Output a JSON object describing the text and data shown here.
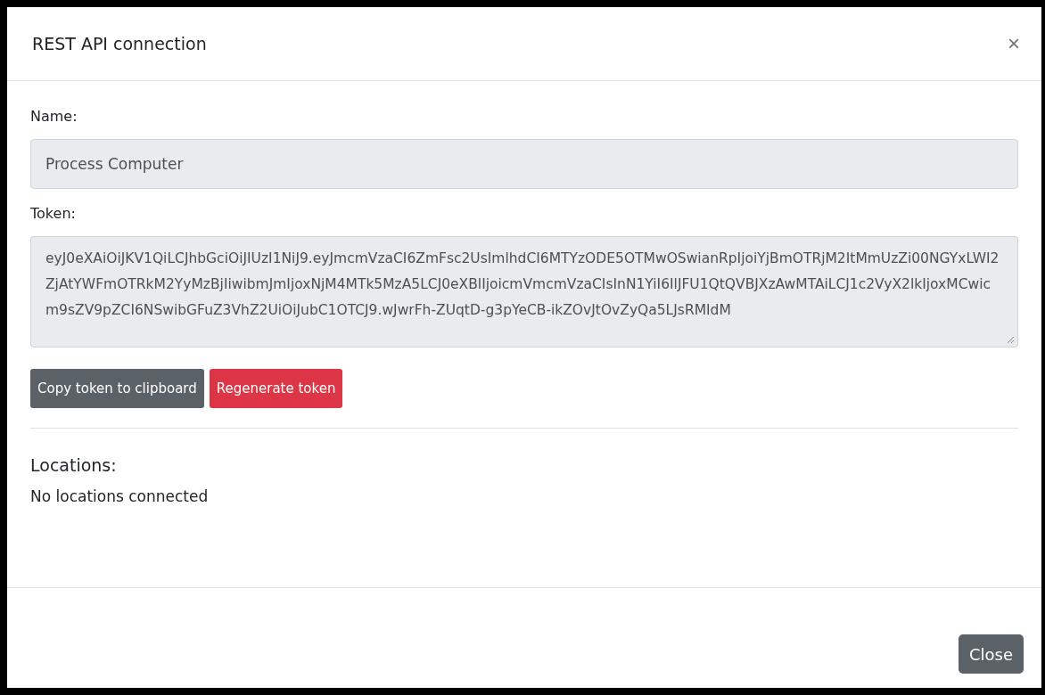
{
  "dialog": {
    "title": "REST API connection",
    "close_glyph": "×"
  },
  "fields": [
    {
      "label": "Name:",
      "value": "Process Computer",
      "kind": "input"
    },
    {
      "label": "Token:",
      "value": "eyJ0eXAiOiJKV1QiLCJhbGciOiJIUzI1NiJ9.eyJmcmVzaCI6ZmFsc2UsImlhdCI6MTYzODE5OTMwOSwianRpIjoiYjBmOTRjM2ItMmUzZi00NGYxLWI2ZjAtYWFmOTRkM2YyMzBjIiwibmJmIjoxNjM4MTk5MzA5LCJ0eXBlIjoicmVmcmVzaCIsInN1YiI6IlJFU1QtQVBJXzAwMTAiLCJ1c2VyX2lkIjoxMCwicm9sZV9pZCI6NSwibGFuZ3VhZ2UiOiJubC1OTCJ9.wJwrFh-ZUqtD-g3pYeCB-ikZOvJtOvZyQa5LJsRMIdM",
      "kind": "textarea"
    }
  ],
  "token_buttons": [
    {
      "label": "Copy token to clipboard",
      "kind": "secondary"
    },
    {
      "label": "Regenerate token",
      "kind": "danger"
    }
  ],
  "locations": {
    "heading": "Locations:",
    "empty_text": "No locations connected"
  },
  "footer_buttons": [
    {
      "label": "Close",
      "kind": "secondary"
    }
  ]
}
